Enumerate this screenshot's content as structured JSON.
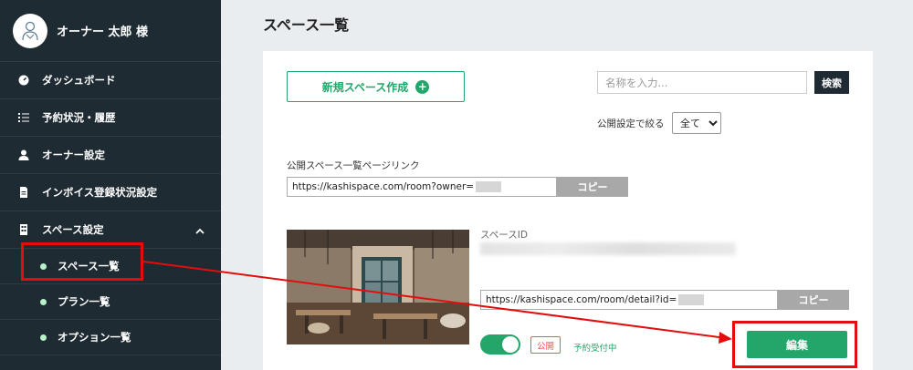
{
  "sidebar": {
    "user_name": "オーナー 太郎 様",
    "items": [
      {
        "label": "ダッシュボード",
        "icon": "dashboard-icon"
      },
      {
        "label": "予約状況・履歴",
        "icon": "list-icon"
      },
      {
        "label": "オーナー設定",
        "icon": "person-icon"
      },
      {
        "label": "インボイス登録状況設定",
        "icon": "document-icon"
      },
      {
        "label": "スペース設定",
        "icon": "building-icon"
      }
    ],
    "sub_items": [
      {
        "label": "スペース一覧"
      },
      {
        "label": "プラン一覧"
      },
      {
        "label": "オプション一覧"
      }
    ]
  },
  "main": {
    "title": "スペース一覧",
    "new_button": "新規スペース作成",
    "search_placeholder": "名称を入力...",
    "search_button": "検索",
    "filter_label": "公開設定で絞る",
    "filter_value": "全て",
    "link_label": "公開スペース一覧ページリンク",
    "link_url": "https://kashispace.com/room?owner=",
    "copy_label": "コピー",
    "space": {
      "id_label": "スペースID",
      "detail_url": "https://kashispace.com/room/detail?id=",
      "badge": "公開",
      "status": "予約受付中",
      "edit_button": "編集"
    }
  },
  "colors": {
    "sidebar_bg": "#1f2b33",
    "accent_green": "#24a66a",
    "highlight_red": "#e30d0d"
  }
}
